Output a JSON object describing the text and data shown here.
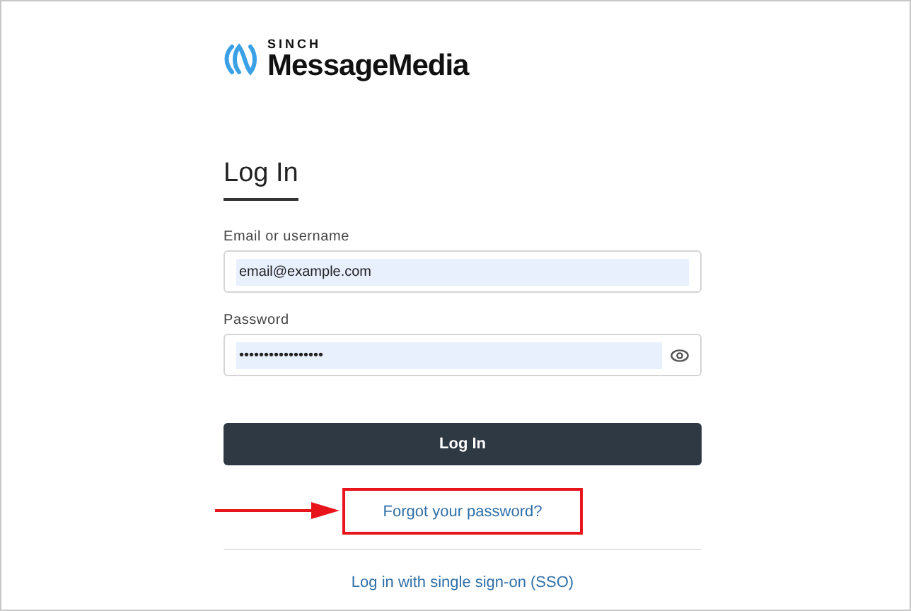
{
  "logo": {
    "brand": "SINCH",
    "product": "MessageMedia"
  },
  "heading": "Log In",
  "fields": [
    {
      "kind": "text",
      "label": "Email or username",
      "value": "email@example.com"
    },
    {
      "kind": "password",
      "label": "Password",
      "value": "•••••••••••••••••"
    }
  ],
  "submit": "Log In",
  "forgot_link": {
    "label": "Forgot your password?",
    "highlighted": true
  },
  "sso_link": "Log in with single sign-on (SSO)"
}
